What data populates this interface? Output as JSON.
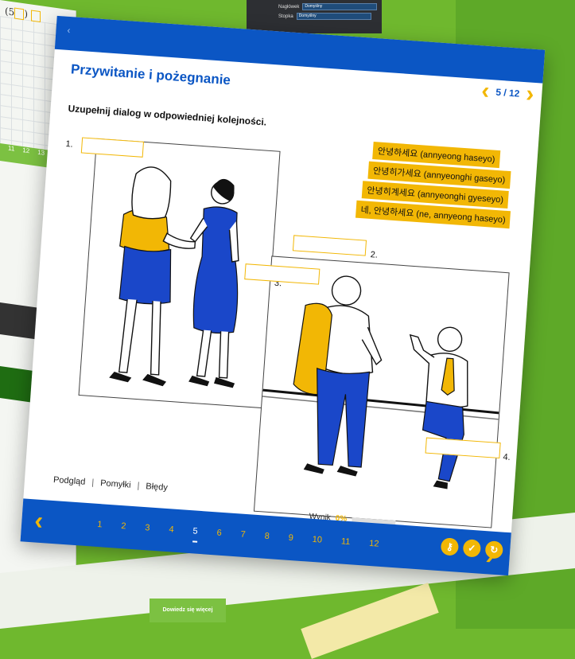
{
  "background": {
    "formula": "(5",
    "grid_numbers": [
      "11",
      "12",
      "13"
    ],
    "top_panel": {
      "rows": [
        {
          "label": "Nagłówek",
          "value": "Domyślny"
        },
        {
          "label": "Stopka",
          "value": "Domyślny"
        }
      ]
    },
    "learn_more_button": "Dowiedz się więcej"
  },
  "exercise": {
    "title": "Przywitanie i pożegnanie",
    "instruction": "Uzupełnij dialog w odpowiedniej kolejności.",
    "pager": {
      "current": 5,
      "total": 12,
      "label": "5 / 12"
    },
    "slots": [
      {
        "number": "1."
      },
      {
        "number": "2."
      },
      {
        "number": "3."
      },
      {
        "number": "4."
      }
    ],
    "phrases": [
      "안녕하세요 (annyeong haseyo)",
      "안녕히가세요 (annyeonghi gaseyo)",
      "안녕히계세요 (annyeonghi gyeseyo)",
      "네, 안녕하세요 (ne, annyeong haseyo)"
    ]
  },
  "footer": {
    "tabs": [
      "Podgląd",
      "Pomyłki",
      "Błędy"
    ],
    "separator": "|",
    "score_label": "Wynik",
    "score_value": "0%",
    "pages": [
      "1",
      "2",
      "3",
      "4",
      "5",
      "6",
      "7",
      "8",
      "9",
      "10",
      "11",
      "12"
    ],
    "active_page": "5"
  },
  "colors": {
    "primary_blue": "#0b56c4",
    "accent_yellow": "#f2b705",
    "background_green": "#6fb82e"
  },
  "icons": {
    "key": "key-icon",
    "check": "check-icon",
    "retry": "retry-icon",
    "prev": "chevron-left-icon",
    "next": "chevron-right-icon"
  }
}
